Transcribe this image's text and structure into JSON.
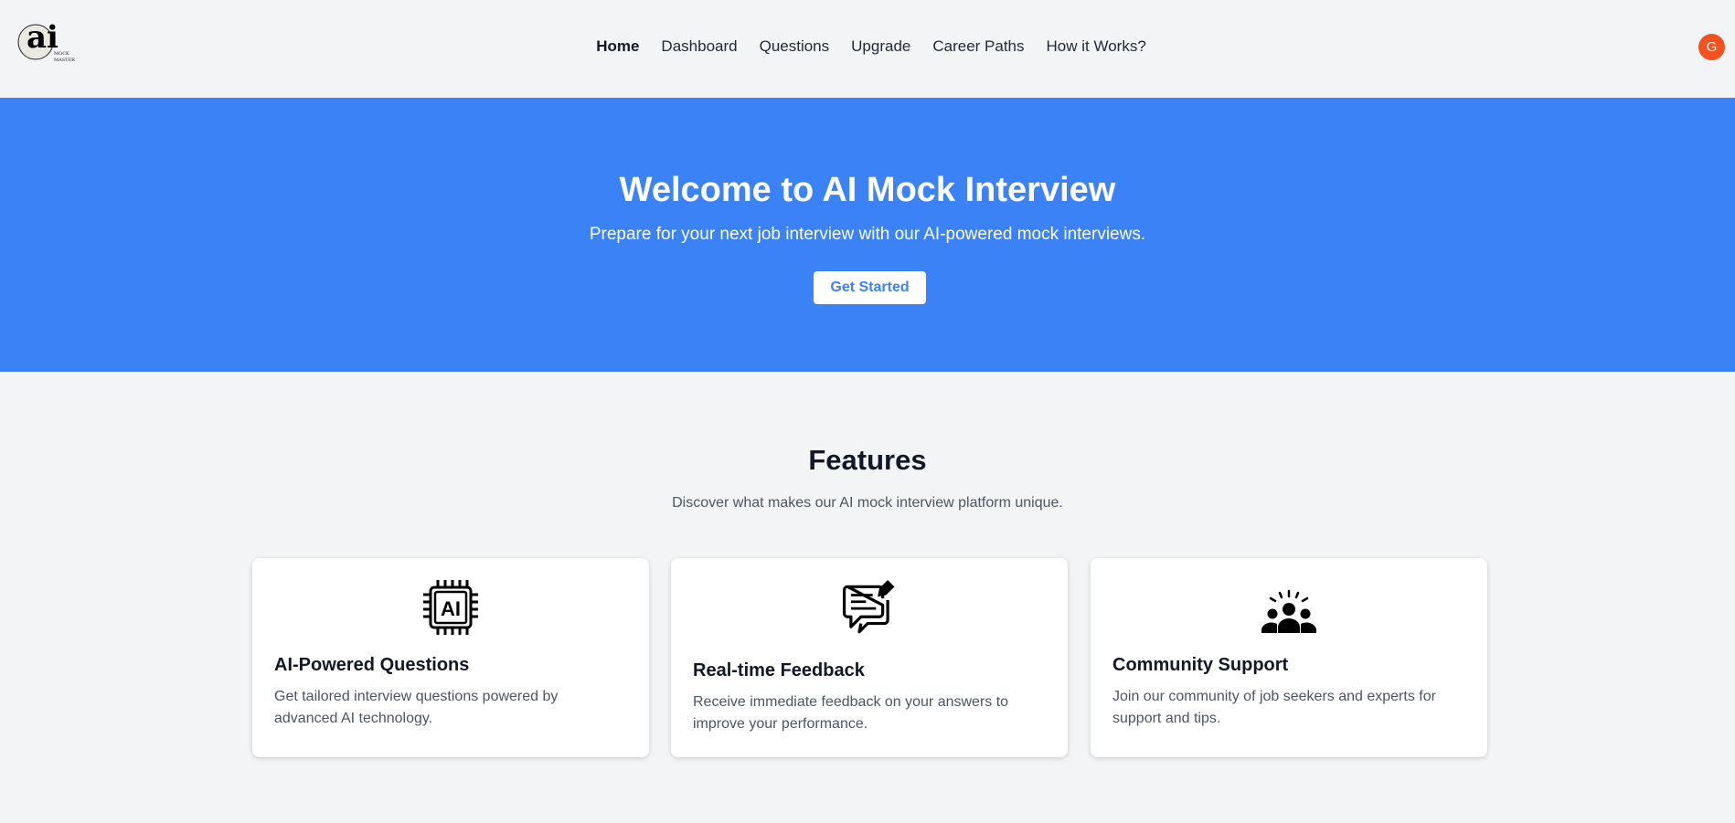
{
  "nav": {
    "items": [
      {
        "label": "Home",
        "active": true
      },
      {
        "label": "Dashboard"
      },
      {
        "label": "Questions"
      },
      {
        "label": "Upgrade"
      },
      {
        "label": "Career Paths"
      },
      {
        "label": "How it Works?"
      }
    ]
  },
  "logo": {
    "main": "ai",
    "sub1": "MOCK",
    "sub2": "MASTER"
  },
  "user": {
    "avatar_initial": "G",
    "avatar_color": "#f4511e"
  },
  "hero": {
    "title": "Welcome to AI Mock Interview",
    "subtitle": "Prepare for your next job interview with our AI-powered mock interviews.",
    "cta": "Get Started",
    "background": "#3b82f6"
  },
  "features": {
    "title": "Features",
    "subtitle": "Discover what makes our AI mock interview platform unique.",
    "cards": [
      {
        "icon": "ai-chip-icon",
        "title": "AI-Powered Questions",
        "text_line1": "Get tailored interview questions powered by",
        "text_line2": "advanced AI technology."
      },
      {
        "icon": "feedback-chat-icon",
        "title": "Real-time Feedback",
        "text_line1": "Receive immediate feedback on your answers to",
        "text_line2": "improve your performance."
      },
      {
        "icon": "community-icon",
        "title": "Community Support",
        "text_line1": "Join our community of job seekers and experts for",
        "text_line2": "support and tips."
      }
    ]
  }
}
